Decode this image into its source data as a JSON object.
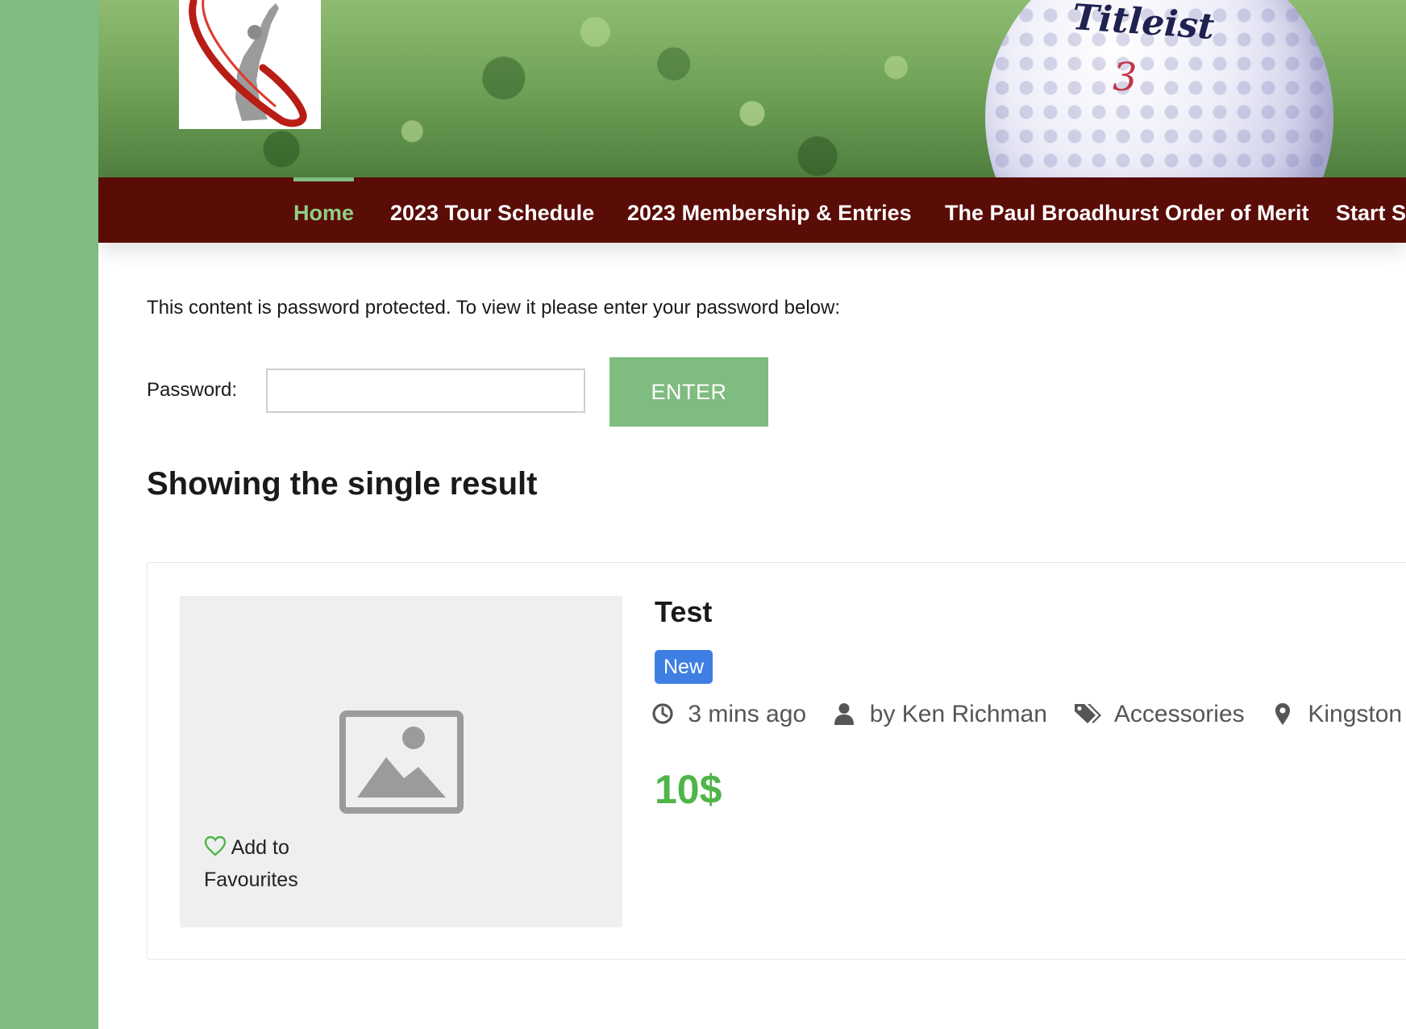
{
  "header": {
    "ball_brand": "Titleist",
    "ball_number": "3"
  },
  "nav": {
    "items": [
      {
        "label": "Home",
        "active": true
      },
      {
        "label": "2023 Tour Schedule"
      },
      {
        "label": "2023 Membership & Entries"
      },
      {
        "label": "The Paul Broadhurst Order of Merit"
      },
      {
        "label": "Start S"
      }
    ]
  },
  "main": {
    "protected_message": "This content is password protected. To view it please enter your password below:",
    "password_label": "Password:",
    "password_value": "",
    "enter_label": "ENTER",
    "results_heading": "Showing the single result"
  },
  "listing": {
    "title": "Test",
    "badge": "New",
    "favourite_label": "Add to Favourites",
    "time": "3 mins ago",
    "author": "by Ken Richman",
    "category": "Accessories",
    "location": "Kingston",
    "price": "10$"
  },
  "colors": {
    "side_green": "#7fbc7f",
    "nav_maroon": "#5a0c07",
    "nav_active": "#8fcf86",
    "badge_blue": "#3f7fe3",
    "price_green": "#4fb548"
  },
  "icons": {
    "time": "clock-icon",
    "author": "user-icon",
    "category": "tags-icon",
    "location": "map-pin-icon",
    "favourite": "heart-icon",
    "thumbnail": "image-placeholder-icon"
  }
}
